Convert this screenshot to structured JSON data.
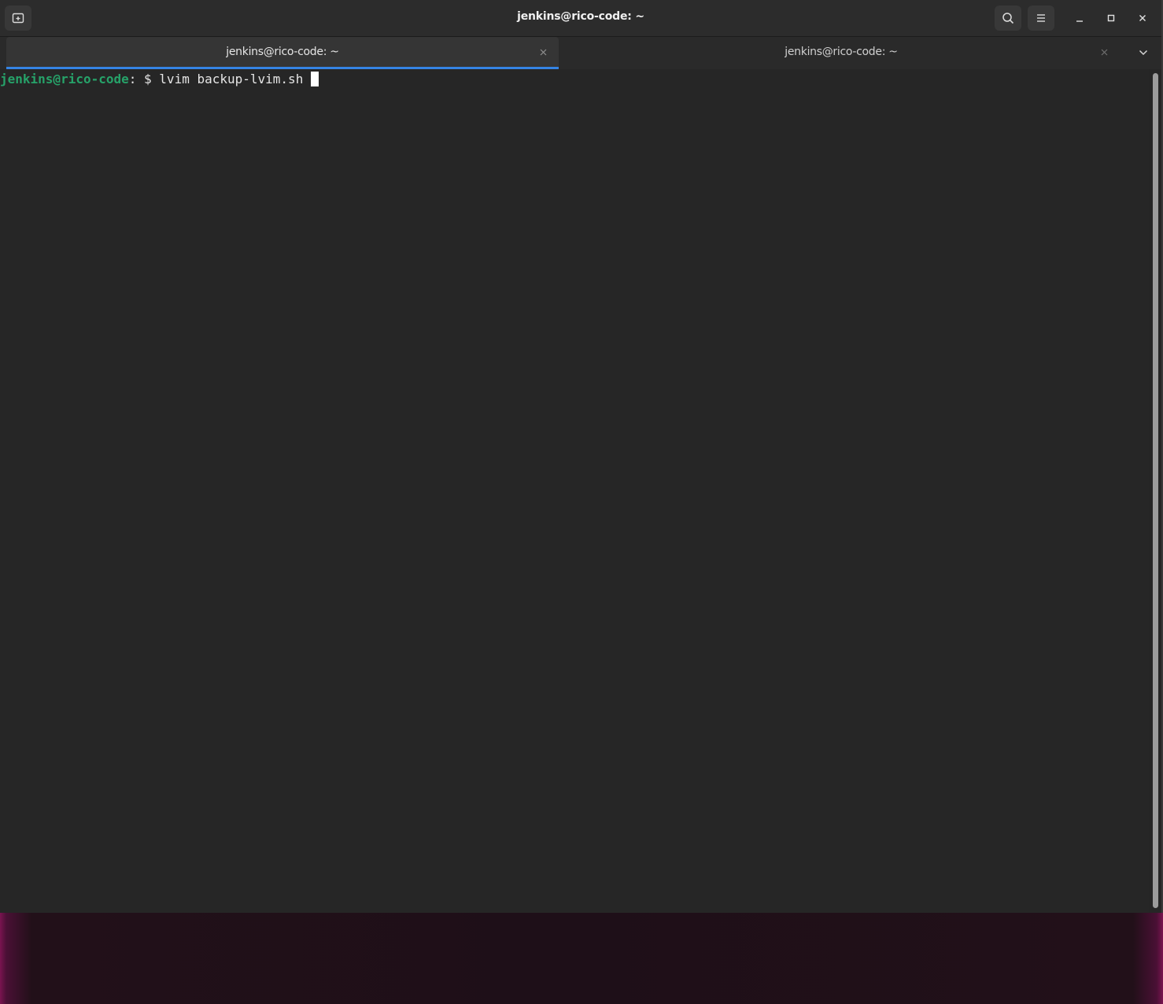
{
  "window": {
    "title": "jenkins@rico-code: ~",
    "header_icons": {
      "new_tab": "new-tab-icon",
      "search": "search-icon",
      "menu": "hamburger-menu-icon",
      "minimize": "minimize-icon",
      "maximize": "maximize-icon",
      "close": "close-icon"
    }
  },
  "tabs": [
    {
      "label": "jenkins@rico-code: ~",
      "active": true
    },
    {
      "label": "jenkins@rico-code: ~",
      "active": false
    }
  ],
  "terminal": {
    "user_host": "jenkins@rico-code",
    "path_part": ": $ ",
    "command": "lvim backup-lvim.sh ",
    "colors": {
      "prompt_user": "#26a269",
      "text": "#e6e6e6",
      "background": "#262626",
      "tab_indicator": "#3584e4"
    }
  }
}
